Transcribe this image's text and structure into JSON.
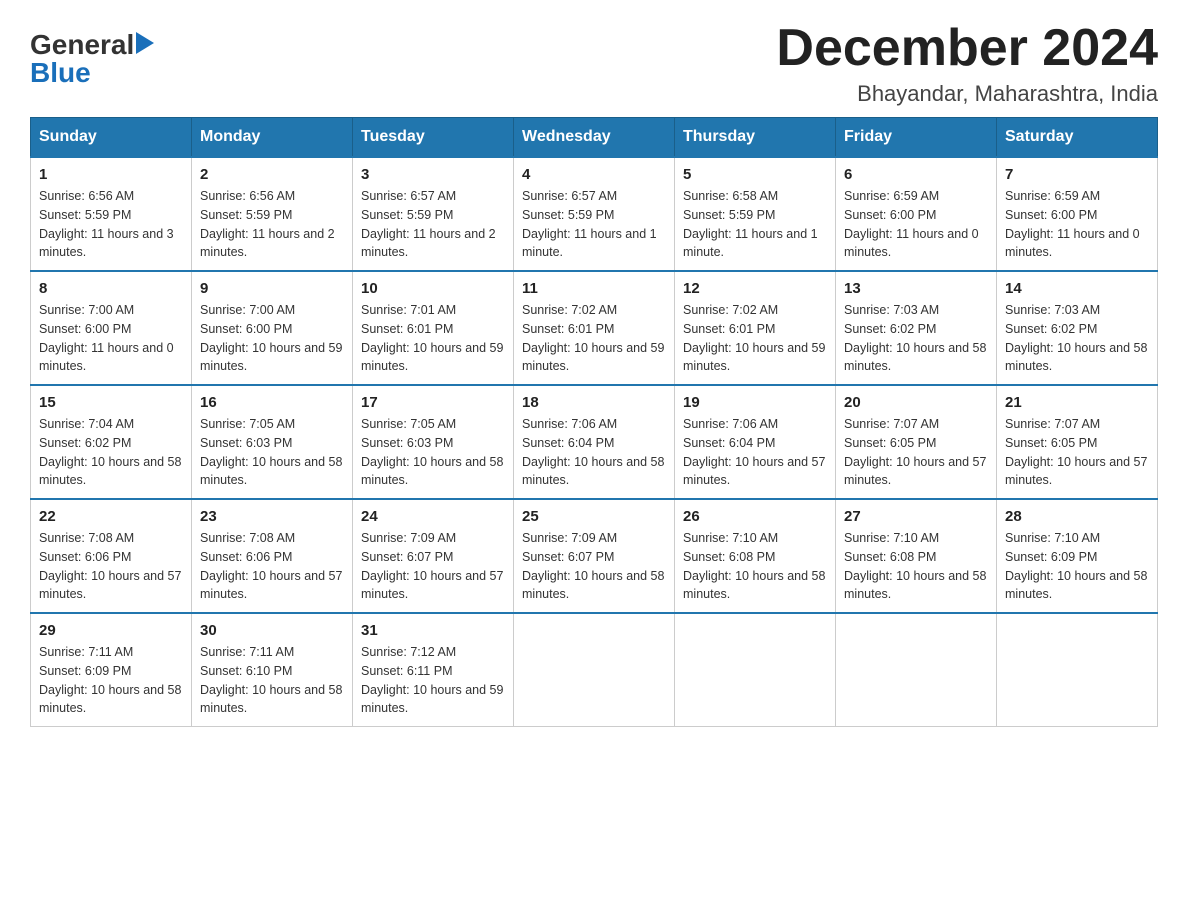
{
  "logo": {
    "text_general": "General",
    "text_blue": "Blue",
    "triangle": "▶"
  },
  "title": {
    "month": "December 2024",
    "location": "Bhayandar, Maharashtra, India"
  },
  "weekdays": [
    "Sunday",
    "Monday",
    "Tuesday",
    "Wednesday",
    "Thursday",
    "Friday",
    "Saturday"
  ],
  "weeks": [
    [
      {
        "day": "1",
        "sunrise": "6:56 AM",
        "sunset": "5:59 PM",
        "daylight": "11 hours and 3 minutes."
      },
      {
        "day": "2",
        "sunrise": "6:56 AM",
        "sunset": "5:59 PM",
        "daylight": "11 hours and 2 minutes."
      },
      {
        "day": "3",
        "sunrise": "6:57 AM",
        "sunset": "5:59 PM",
        "daylight": "11 hours and 2 minutes."
      },
      {
        "day": "4",
        "sunrise": "6:57 AM",
        "sunset": "5:59 PM",
        "daylight": "11 hours and 1 minute."
      },
      {
        "day": "5",
        "sunrise": "6:58 AM",
        "sunset": "5:59 PM",
        "daylight": "11 hours and 1 minute."
      },
      {
        "day": "6",
        "sunrise": "6:59 AM",
        "sunset": "6:00 PM",
        "daylight": "11 hours and 0 minutes."
      },
      {
        "day": "7",
        "sunrise": "6:59 AM",
        "sunset": "6:00 PM",
        "daylight": "11 hours and 0 minutes."
      }
    ],
    [
      {
        "day": "8",
        "sunrise": "7:00 AM",
        "sunset": "6:00 PM",
        "daylight": "11 hours and 0 minutes."
      },
      {
        "day": "9",
        "sunrise": "7:00 AM",
        "sunset": "6:00 PM",
        "daylight": "10 hours and 59 minutes."
      },
      {
        "day": "10",
        "sunrise": "7:01 AM",
        "sunset": "6:01 PM",
        "daylight": "10 hours and 59 minutes."
      },
      {
        "day": "11",
        "sunrise": "7:02 AM",
        "sunset": "6:01 PM",
        "daylight": "10 hours and 59 minutes."
      },
      {
        "day": "12",
        "sunrise": "7:02 AM",
        "sunset": "6:01 PM",
        "daylight": "10 hours and 59 minutes."
      },
      {
        "day": "13",
        "sunrise": "7:03 AM",
        "sunset": "6:02 PM",
        "daylight": "10 hours and 58 minutes."
      },
      {
        "day": "14",
        "sunrise": "7:03 AM",
        "sunset": "6:02 PM",
        "daylight": "10 hours and 58 minutes."
      }
    ],
    [
      {
        "day": "15",
        "sunrise": "7:04 AM",
        "sunset": "6:02 PM",
        "daylight": "10 hours and 58 minutes."
      },
      {
        "day": "16",
        "sunrise": "7:05 AM",
        "sunset": "6:03 PM",
        "daylight": "10 hours and 58 minutes."
      },
      {
        "day": "17",
        "sunrise": "7:05 AM",
        "sunset": "6:03 PM",
        "daylight": "10 hours and 58 minutes."
      },
      {
        "day": "18",
        "sunrise": "7:06 AM",
        "sunset": "6:04 PM",
        "daylight": "10 hours and 58 minutes."
      },
      {
        "day": "19",
        "sunrise": "7:06 AM",
        "sunset": "6:04 PM",
        "daylight": "10 hours and 57 minutes."
      },
      {
        "day": "20",
        "sunrise": "7:07 AM",
        "sunset": "6:05 PM",
        "daylight": "10 hours and 57 minutes."
      },
      {
        "day": "21",
        "sunrise": "7:07 AM",
        "sunset": "6:05 PM",
        "daylight": "10 hours and 57 minutes."
      }
    ],
    [
      {
        "day": "22",
        "sunrise": "7:08 AM",
        "sunset": "6:06 PM",
        "daylight": "10 hours and 57 minutes."
      },
      {
        "day": "23",
        "sunrise": "7:08 AM",
        "sunset": "6:06 PM",
        "daylight": "10 hours and 57 minutes."
      },
      {
        "day": "24",
        "sunrise": "7:09 AM",
        "sunset": "6:07 PM",
        "daylight": "10 hours and 57 minutes."
      },
      {
        "day": "25",
        "sunrise": "7:09 AM",
        "sunset": "6:07 PM",
        "daylight": "10 hours and 58 minutes."
      },
      {
        "day": "26",
        "sunrise": "7:10 AM",
        "sunset": "6:08 PM",
        "daylight": "10 hours and 58 minutes."
      },
      {
        "day": "27",
        "sunrise": "7:10 AM",
        "sunset": "6:08 PM",
        "daylight": "10 hours and 58 minutes."
      },
      {
        "day": "28",
        "sunrise": "7:10 AM",
        "sunset": "6:09 PM",
        "daylight": "10 hours and 58 minutes."
      }
    ],
    [
      {
        "day": "29",
        "sunrise": "7:11 AM",
        "sunset": "6:09 PM",
        "daylight": "10 hours and 58 minutes."
      },
      {
        "day": "30",
        "sunrise": "7:11 AM",
        "sunset": "6:10 PM",
        "daylight": "10 hours and 58 minutes."
      },
      {
        "day": "31",
        "sunrise": "7:12 AM",
        "sunset": "6:11 PM",
        "daylight": "10 hours and 59 minutes."
      },
      null,
      null,
      null,
      null
    ]
  ]
}
